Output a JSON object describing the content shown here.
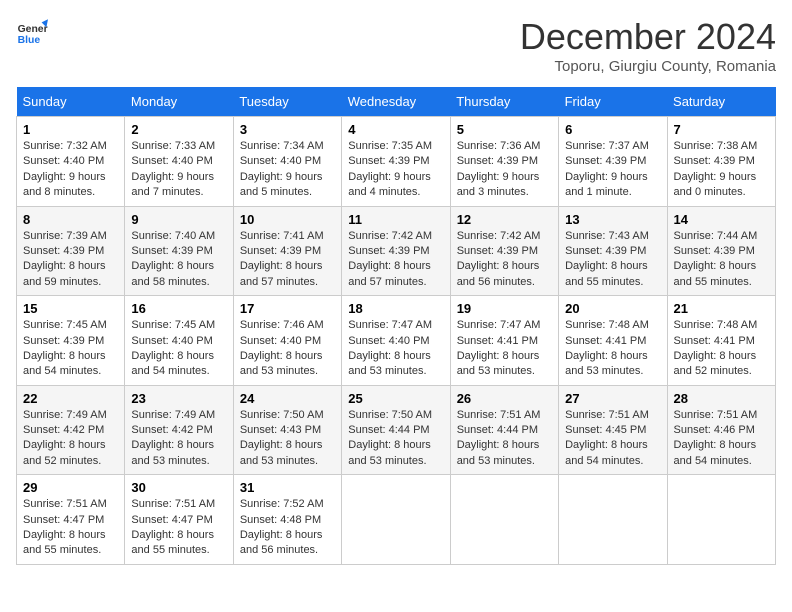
{
  "header": {
    "logo_general": "General",
    "logo_blue": "Blue",
    "month_title": "December 2024",
    "location": "Toporu, Giurgiu County, Romania"
  },
  "weekdays": [
    "Sunday",
    "Monday",
    "Tuesday",
    "Wednesday",
    "Thursday",
    "Friday",
    "Saturday"
  ],
  "weeks": [
    [
      {
        "day": "1",
        "lines": [
          "Sunrise: 7:32 AM",
          "Sunset: 4:40 PM",
          "Daylight: 9 hours",
          "and 8 minutes."
        ]
      },
      {
        "day": "2",
        "lines": [
          "Sunrise: 7:33 AM",
          "Sunset: 4:40 PM",
          "Daylight: 9 hours",
          "and 7 minutes."
        ]
      },
      {
        "day": "3",
        "lines": [
          "Sunrise: 7:34 AM",
          "Sunset: 4:40 PM",
          "Daylight: 9 hours",
          "and 5 minutes."
        ]
      },
      {
        "day": "4",
        "lines": [
          "Sunrise: 7:35 AM",
          "Sunset: 4:39 PM",
          "Daylight: 9 hours",
          "and 4 minutes."
        ]
      },
      {
        "day": "5",
        "lines": [
          "Sunrise: 7:36 AM",
          "Sunset: 4:39 PM",
          "Daylight: 9 hours",
          "and 3 minutes."
        ]
      },
      {
        "day": "6",
        "lines": [
          "Sunrise: 7:37 AM",
          "Sunset: 4:39 PM",
          "Daylight: 9 hours",
          "and 1 minute."
        ]
      },
      {
        "day": "7",
        "lines": [
          "Sunrise: 7:38 AM",
          "Sunset: 4:39 PM",
          "Daylight: 9 hours",
          "and 0 minutes."
        ]
      }
    ],
    [
      {
        "day": "8",
        "lines": [
          "Sunrise: 7:39 AM",
          "Sunset: 4:39 PM",
          "Daylight: 8 hours",
          "and 59 minutes."
        ]
      },
      {
        "day": "9",
        "lines": [
          "Sunrise: 7:40 AM",
          "Sunset: 4:39 PM",
          "Daylight: 8 hours",
          "and 58 minutes."
        ]
      },
      {
        "day": "10",
        "lines": [
          "Sunrise: 7:41 AM",
          "Sunset: 4:39 PM",
          "Daylight: 8 hours",
          "and 57 minutes."
        ]
      },
      {
        "day": "11",
        "lines": [
          "Sunrise: 7:42 AM",
          "Sunset: 4:39 PM",
          "Daylight: 8 hours",
          "and 57 minutes."
        ]
      },
      {
        "day": "12",
        "lines": [
          "Sunrise: 7:42 AM",
          "Sunset: 4:39 PM",
          "Daylight: 8 hours",
          "and 56 minutes."
        ]
      },
      {
        "day": "13",
        "lines": [
          "Sunrise: 7:43 AM",
          "Sunset: 4:39 PM",
          "Daylight: 8 hours",
          "and 55 minutes."
        ]
      },
      {
        "day": "14",
        "lines": [
          "Sunrise: 7:44 AM",
          "Sunset: 4:39 PM",
          "Daylight: 8 hours",
          "and 55 minutes."
        ]
      }
    ],
    [
      {
        "day": "15",
        "lines": [
          "Sunrise: 7:45 AM",
          "Sunset: 4:39 PM",
          "Daylight: 8 hours",
          "and 54 minutes."
        ]
      },
      {
        "day": "16",
        "lines": [
          "Sunrise: 7:45 AM",
          "Sunset: 4:40 PM",
          "Daylight: 8 hours",
          "and 54 minutes."
        ]
      },
      {
        "day": "17",
        "lines": [
          "Sunrise: 7:46 AM",
          "Sunset: 4:40 PM",
          "Daylight: 8 hours",
          "and 53 minutes."
        ]
      },
      {
        "day": "18",
        "lines": [
          "Sunrise: 7:47 AM",
          "Sunset: 4:40 PM",
          "Daylight: 8 hours",
          "and 53 minutes."
        ]
      },
      {
        "day": "19",
        "lines": [
          "Sunrise: 7:47 AM",
          "Sunset: 4:41 PM",
          "Daylight: 8 hours",
          "and 53 minutes."
        ]
      },
      {
        "day": "20",
        "lines": [
          "Sunrise: 7:48 AM",
          "Sunset: 4:41 PM",
          "Daylight: 8 hours",
          "and 53 minutes."
        ]
      },
      {
        "day": "21",
        "lines": [
          "Sunrise: 7:48 AM",
          "Sunset: 4:41 PM",
          "Daylight: 8 hours",
          "and 52 minutes."
        ]
      }
    ],
    [
      {
        "day": "22",
        "lines": [
          "Sunrise: 7:49 AM",
          "Sunset: 4:42 PM",
          "Daylight: 8 hours",
          "and 52 minutes."
        ]
      },
      {
        "day": "23",
        "lines": [
          "Sunrise: 7:49 AM",
          "Sunset: 4:42 PM",
          "Daylight: 8 hours",
          "and 53 minutes."
        ]
      },
      {
        "day": "24",
        "lines": [
          "Sunrise: 7:50 AM",
          "Sunset: 4:43 PM",
          "Daylight: 8 hours",
          "and 53 minutes."
        ]
      },
      {
        "day": "25",
        "lines": [
          "Sunrise: 7:50 AM",
          "Sunset: 4:44 PM",
          "Daylight: 8 hours",
          "and 53 minutes."
        ]
      },
      {
        "day": "26",
        "lines": [
          "Sunrise: 7:51 AM",
          "Sunset: 4:44 PM",
          "Daylight: 8 hours",
          "and 53 minutes."
        ]
      },
      {
        "day": "27",
        "lines": [
          "Sunrise: 7:51 AM",
          "Sunset: 4:45 PM",
          "Daylight: 8 hours",
          "and 54 minutes."
        ]
      },
      {
        "day": "28",
        "lines": [
          "Sunrise: 7:51 AM",
          "Sunset: 4:46 PM",
          "Daylight: 8 hours",
          "and 54 minutes."
        ]
      }
    ],
    [
      {
        "day": "29",
        "lines": [
          "Sunrise: 7:51 AM",
          "Sunset: 4:47 PM",
          "Daylight: 8 hours",
          "and 55 minutes."
        ]
      },
      {
        "day": "30",
        "lines": [
          "Sunrise: 7:51 AM",
          "Sunset: 4:47 PM",
          "Daylight: 8 hours",
          "and 55 minutes."
        ]
      },
      {
        "day": "31",
        "lines": [
          "Sunrise: 7:52 AM",
          "Sunset: 4:48 PM",
          "Daylight: 8 hours",
          "and 56 minutes."
        ]
      },
      null,
      null,
      null,
      null
    ]
  ]
}
